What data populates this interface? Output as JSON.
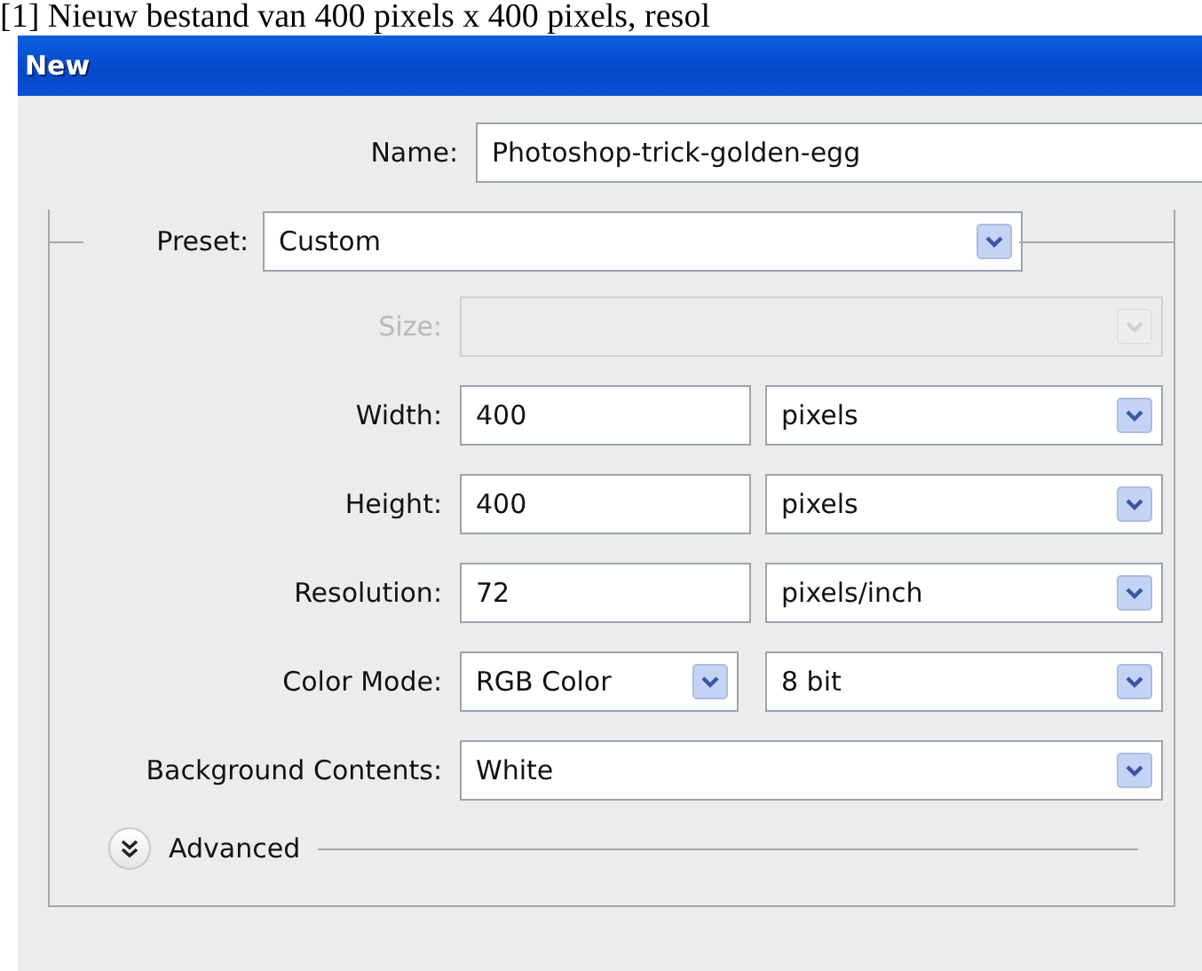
{
  "caption": "[1] Nieuw bestand van 400 pixels x 400 pixels, resol",
  "window": {
    "title": "New"
  },
  "name": {
    "label": "Name:",
    "value": "Photoshop-trick-golden-egg"
  },
  "preset": {
    "label": "Preset:",
    "value": "Custom"
  },
  "rows": [
    {
      "kind": "wide_select",
      "label": "Size:",
      "disabled": true
    },
    {
      "kind": "value_unit",
      "label": "Width:",
      "value": "400",
      "unit": "pixels",
      "disabled": false
    },
    {
      "kind": "value_unit",
      "label": "Height:",
      "value": "400",
      "unit": "pixels",
      "disabled": false
    },
    {
      "kind": "value_unit",
      "label": "Resolution:",
      "value": "72",
      "unit": "pixels/inch",
      "disabled": false
    },
    {
      "kind": "select_pair",
      "label": "Color Mode:",
      "value": "RGB Color",
      "unit": "8 bit",
      "disabled": false
    },
    {
      "kind": "wide_select",
      "label": "Background Contents:",
      "value": "White",
      "disabled": false
    }
  ],
  "advanced": {
    "label": "Advanced",
    "expanded": false
  }
}
